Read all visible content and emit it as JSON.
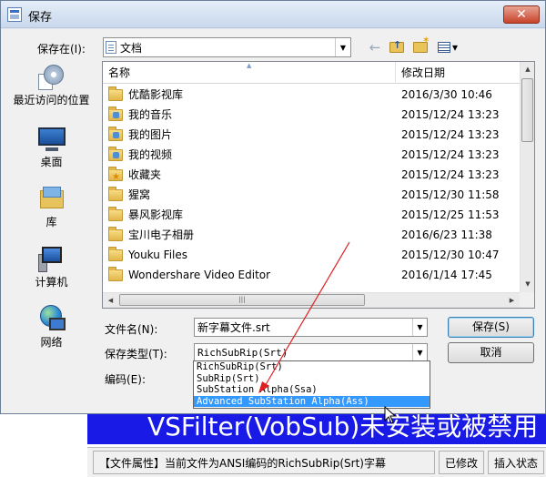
{
  "background_app": {
    "banner_text": "VSFilter(VobSub)未安装或被禁用",
    "status": {
      "file_info": "【文件属性】当前文件为ANSI编码的RichSubRip(Srt)字幕",
      "modified": "已修改",
      "insert_mode": "插入状态"
    }
  },
  "dialog": {
    "title": "保存",
    "close_glyph": "✕",
    "save_in_label": "保存在(I):",
    "location": "文档",
    "toolbar": {
      "back_glyph": "←",
      "views_arrow": "▾"
    }
  },
  "places": [
    {
      "label": "最近访问的位置",
      "icon": "recent-places-icon"
    },
    {
      "label": "桌面",
      "icon": "desktop-icon"
    },
    {
      "label": "库",
      "icon": "libraries-icon"
    },
    {
      "label": "计算机",
      "icon": "computer-icon"
    },
    {
      "label": "网络",
      "icon": "network-icon"
    }
  ],
  "file_list": {
    "columns": {
      "name": "名称",
      "date": "修改日期"
    },
    "sort_glyph": "▲",
    "rows": [
      {
        "name": "优酷影视库",
        "date": "2016/3/30 10:46",
        "icon": "folder"
      },
      {
        "name": "我的音乐",
        "date": "2015/12/24 13:23",
        "icon": "special"
      },
      {
        "name": "我的图片",
        "date": "2015/12/24 13:23",
        "icon": "special"
      },
      {
        "name": "我的视频",
        "date": "2015/12/24 13:23",
        "icon": "special"
      },
      {
        "name": "收藏夹",
        "date": "2015/12/24 13:23",
        "icon": "star"
      },
      {
        "name": "猩窝",
        "date": "2015/12/30 11:58",
        "icon": "folder"
      },
      {
        "name": "暴风影视库",
        "date": "2015/12/25 11:53",
        "icon": "folder"
      },
      {
        "name": "宝川电子相册",
        "date": "2016/6/23 11:38",
        "icon": "folder"
      },
      {
        "name": "Youku Files",
        "date": "2015/12/30 10:47",
        "icon": "folder"
      },
      {
        "name": "Wondershare Video Editor",
        "date": "2016/1/14 17:45",
        "icon": "folder"
      }
    ],
    "scroll_grip": "|||"
  },
  "form": {
    "filename_label": "文件名(N):",
    "filename_value": "新字幕文件.srt",
    "filetype_label": "保存类型(T):",
    "filetype_value": "RichSubRip(Srt)",
    "encoding_label": "编码(E):",
    "save_button": "保存(S)",
    "cancel_button": "取消",
    "filetype_options": [
      "RichSubRip(Srt)",
      "SubRip(Srt)",
      "SubStation Alpha(Ssa)",
      "Advanced SubStation Alpha(Ass)"
    ],
    "selected_option_index": 3
  },
  "colors": {
    "selection": "#3399ff",
    "banner": "#1a1ae6",
    "annotation_arrow": "#e02020"
  }
}
